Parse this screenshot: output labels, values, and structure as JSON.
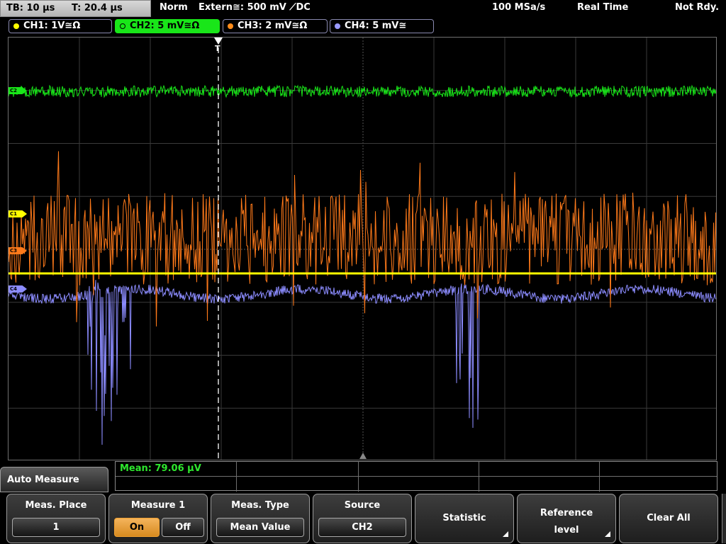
{
  "topbar": {
    "timebase": "TB: 10 µs",
    "trigger_position": "T: 20.4 µs",
    "trigger_mode": "Norm",
    "trigger_source": "Extern≅: 500 mV ⟋DC",
    "sample_rate": "100 MSa/s",
    "acq_mode": "Real Time",
    "status": "Not Rdy."
  },
  "channels": [
    {
      "label": "CH1: 1V≅Ω",
      "color": "#ffff00",
      "active": false
    },
    {
      "label": "CH2: 5 mV≅Ω",
      "color": "#19e619",
      "active": true
    },
    {
      "label": "CH3: 2 mV≅Ω",
      "color": "#ff8c1a",
      "active": false
    },
    {
      "label": "CH4: 5 mV≅",
      "color": "#9a9aff",
      "active": false
    }
  ],
  "markers": {
    "c2": "C2",
    "c1": "C1",
    "c3": "C3",
    "c4": "C4",
    "trigger": "T"
  },
  "colors": {
    "ch1": "#ffff00",
    "ch2": "#19e619",
    "ch3": "#ff7a1a",
    "ch4": "#8c8cff",
    "grid": "#3a3a3a"
  },
  "measurement": {
    "result": "Mean: 79.06 µV"
  },
  "menu": {
    "title": "Auto Measure",
    "meas_place": {
      "label": "Meas. Place",
      "value": "1"
    },
    "measure": {
      "label": "Measure 1",
      "on": "On",
      "off": "Off",
      "selected": "On"
    },
    "meas_type": {
      "label": "Meas. Type",
      "value": "Mean Value"
    },
    "source": {
      "label": "Source",
      "value": "CH2"
    },
    "statistic": {
      "label": "Statistic"
    },
    "reference": {
      "line1": "Reference",
      "line2": "level"
    },
    "clear_all": {
      "label": "Clear All"
    }
  }
}
